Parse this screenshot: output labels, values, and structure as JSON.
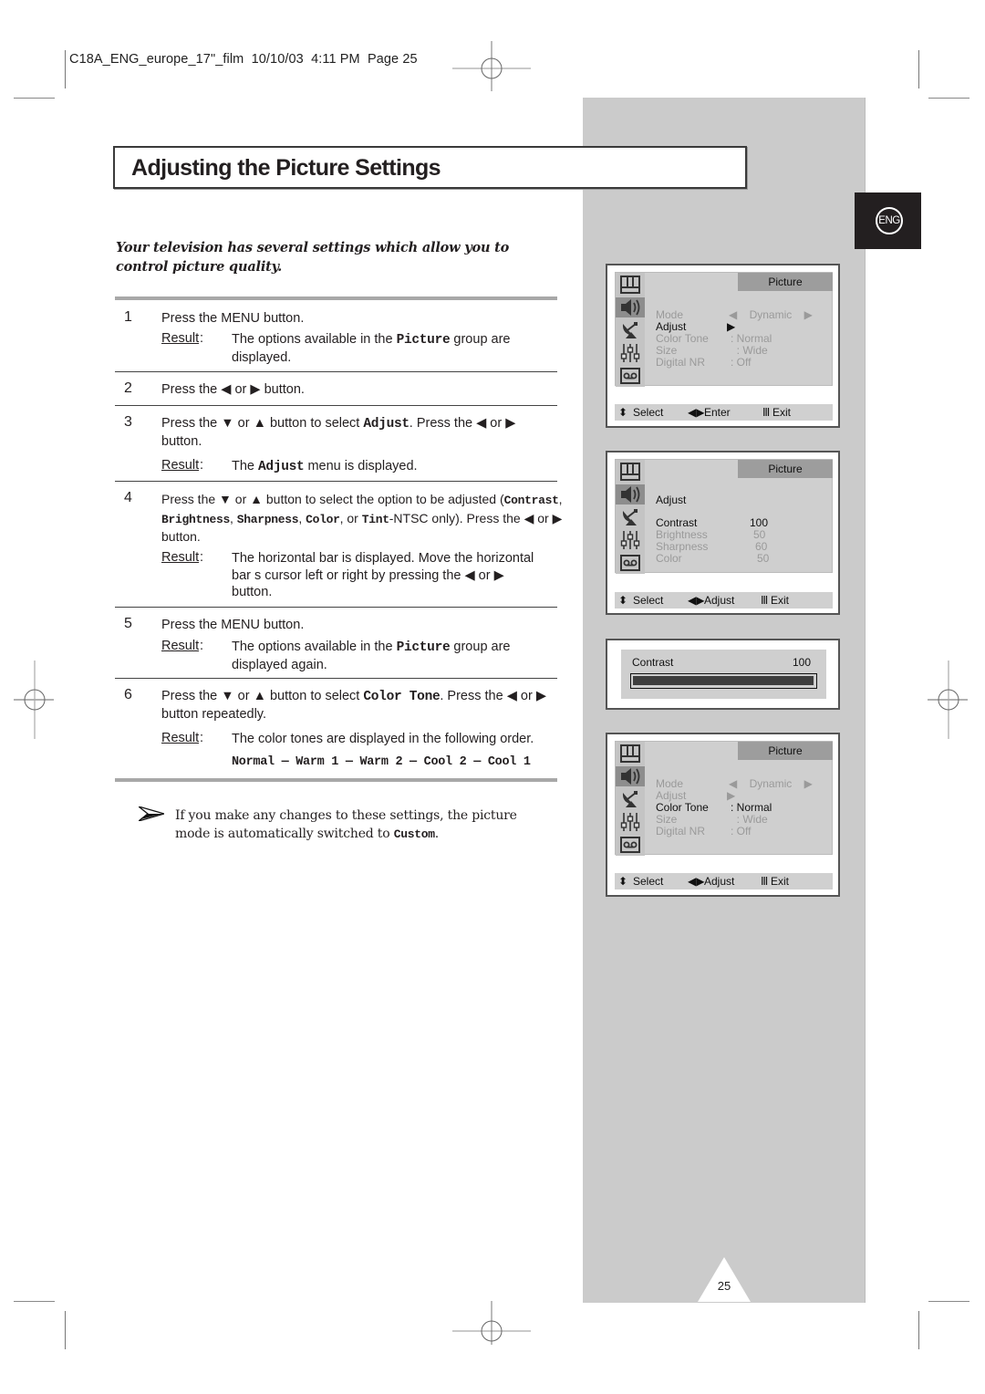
{
  "print_header": "C18A_ENG_europe_17\"_film  10/10/03  4:11 PM  Page 25",
  "title": "Adjusting the Picture Settings",
  "language_badge": "ENG",
  "intro": "Your television has several settings which allow you to control picture quality.",
  "result_label": "Result",
  "steps": [
    {
      "number": "1",
      "text": "Press the MENU button.",
      "result": [
        "The options available in the ",
        "Picture",
        " group are displayed."
      ]
    },
    {
      "number": "2",
      "text": [
        "Press the ",
        "◀",
        " or ",
        "▶",
        " button."
      ]
    },
    {
      "number": "3",
      "text": [
        "Press the ",
        "▼",
        " or ",
        "▲",
        " button to select ",
        "Adjust",
        ". Press the ",
        "◀",
        " or ",
        "▶",
        " button."
      ],
      "result": [
        "The ",
        "Adjust",
        " menu is displayed."
      ]
    },
    {
      "number": "4",
      "text": [
        "Press the ",
        "▼",
        " or ",
        "▲",
        " button to select the option to be adjusted (",
        "Contrast",
        ", ",
        "Brightness",
        ", ",
        "Sharpness",
        ", ",
        "Color",
        ", or ",
        "Tint",
        "-NTSC only). Press the ",
        "◀",
        " or ",
        "▶",
        " button."
      ],
      "result": [
        "The horizontal bar is displayed. Move the horizontal bar s cursor left or right by pressing the ",
        "◀",
        " or ",
        "▶",
        " button."
      ]
    },
    {
      "number": "5",
      "text": "Press the MENU button.",
      "result": [
        "The options available in the ",
        "Picture",
        " group are displayed again."
      ]
    },
    {
      "number": "6",
      "text": [
        "Press the ",
        "▼",
        " or ",
        "▲",
        " button to select ",
        "Color Tone",
        ". Press the ",
        "◀",
        " or ",
        "▶",
        " button repeatedly."
      ],
      "result": "The color tones are displayed in the following order.",
      "tone_sequence": [
        "Normal",
        "Warm 1",
        "Warm 2",
        "Cool 2",
        "Cool 1"
      ]
    }
  ],
  "note": {
    "text": "If you make any changes to these settings, the picture mode is automatically switched to ",
    "keyword": "Custom",
    "end": "."
  },
  "osd_screens": [
    {
      "tab": "Picture",
      "rows": [
        {
          "label": "Mode",
          "value": "◀    Dynamic    ▶",
          "active": false
        },
        {
          "label": "Adjust",
          "value": "▶",
          "active": true
        },
        {
          "label": "Color Tone",
          "value": ": Normal",
          "active": false
        },
        {
          "label": "Size",
          "value": "  : Wide",
          "active": false
        },
        {
          "label": "Digital NR",
          "value": ": Off",
          "active": false
        }
      ],
      "footer": {
        "select": "Select",
        "action": "Enter",
        "exit": "Exit"
      }
    },
    {
      "tab": "Picture",
      "heading": "Adjust",
      "rows": [
        {
          "label": "Contrast",
          "value": "100",
          "active": true
        },
        {
          "label": "Brightness",
          "value": "50",
          "active": false
        },
        {
          "label": "Sharpness",
          "value": "60",
          "active": false
        },
        {
          "label": "Color",
          "value": "50",
          "active": false
        }
      ],
      "footer": {
        "select": "Select",
        "action": "Adjust",
        "exit": "Exit"
      }
    },
    {
      "tab": "Picture",
      "rows": [
        {
          "label": "Mode",
          "value": "◀    Dynamic    ▶",
          "active": false
        },
        {
          "label": "Adjust",
          "value": "▶",
          "active": false
        },
        {
          "label": "Color Tone",
          "value": ": Normal",
          "active": true
        },
        {
          "label": "Size",
          "value": "  : Wide",
          "active": false
        },
        {
          "label": "Digital NR",
          "value": ": Off",
          "active": false
        }
      ],
      "footer": {
        "select": "Select",
        "action": "Adjust",
        "exit": "Exit"
      }
    }
  ],
  "osd_bar": {
    "label": "Contrast",
    "value": "100",
    "fill_percent": 100
  },
  "osd_icons": [
    "picture-icon",
    "sound-icon",
    "channel-icon",
    "setup-icon",
    "input-icon"
  ],
  "page_number": "25"
}
